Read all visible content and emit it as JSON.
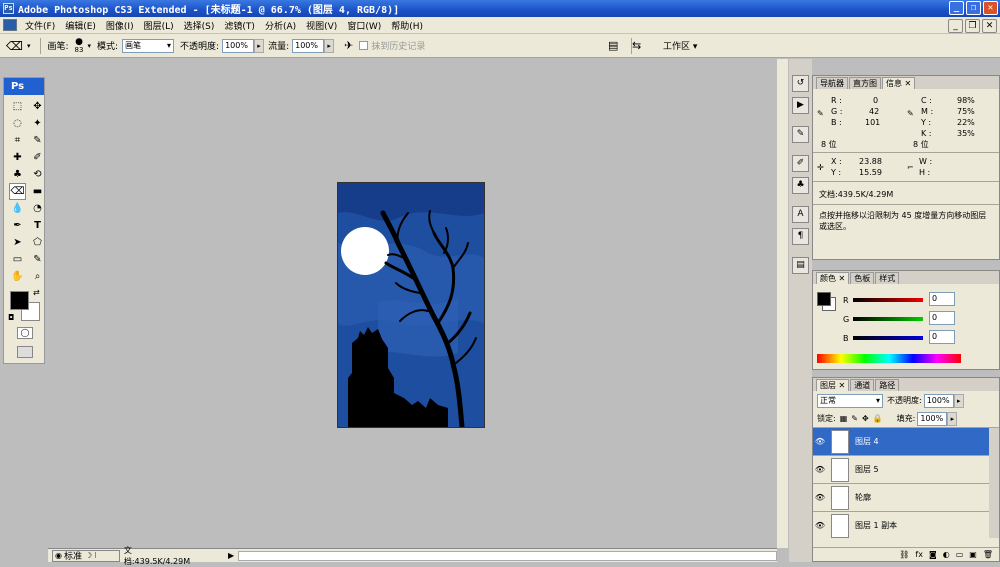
{
  "window": {
    "title": "Adobe Photoshop CS3 Extended - [未标题-1 @ 66.7% (图层 4, RGB/8)]",
    "logo": "Ps"
  },
  "menu": [
    "文件(F)",
    "编辑(E)",
    "图像(I)",
    "图层(L)",
    "选择(S)",
    "滤镜(T)",
    "分析(A)",
    "视图(V)",
    "窗口(W)",
    "帮助(H)"
  ],
  "options": {
    "brush_label": "画笔:",
    "brush_size": "83",
    "mode_label": "模式:",
    "mode_value": "画笔",
    "opacity_label": "不透明度:",
    "opacity_value": "100%",
    "flow_label": "流量:",
    "flow_value": "100%",
    "history_label": "抹到历史记录",
    "workspace_label": "工作区"
  },
  "toolbox": {
    "logo": "Ps"
  },
  "status": {
    "mode": "标准",
    "doc_info": "文档:439.5K/4.29M"
  },
  "info_panel": {
    "tabs": [
      "导航器",
      "直方图",
      "信息"
    ],
    "rgb": {
      "r_label": "R :",
      "r": "0",
      "g_label": "G :",
      "g": "42",
      "b_label": "B :",
      "b": "101"
    },
    "cmyk": {
      "c_label": "C :",
      "c": "98%",
      "m_label": "M :",
      "m": "75%",
      "y_label": "Y :",
      "y": "22%",
      "k_label": "K :",
      "k": "35%"
    },
    "bits_left": "8 位",
    "bits_right": "8 位",
    "xy": {
      "x_label": "X :",
      "x": "23.88",
      "y_label": "Y :",
      "y": "15.59"
    },
    "wh": {
      "w_label": "W :",
      "h_label": "H :"
    },
    "doc": "文档:439.5K/4.29M",
    "hint": "点按并拖移以沿限制为 45 度增量方向移动图层或选区。"
  },
  "color_panel": {
    "tabs": [
      "颜色",
      "色板",
      "样式"
    ],
    "r_label": "R",
    "g_label": "G",
    "b_label": "B",
    "r": "0",
    "g": "0",
    "b": "0"
  },
  "layers_panel": {
    "tabs": [
      "图层",
      "通道",
      "路径"
    ],
    "blend_mode": "正常",
    "opacity_label": "不透明度:",
    "opacity": "100%",
    "lock_label": "锁定:",
    "fill_label": "填充:",
    "fill": "100%",
    "layers": [
      {
        "name": "图层 4",
        "selected": true
      },
      {
        "name": "图层 5",
        "selected": false
      },
      {
        "name": "轮廓",
        "selected": false
      },
      {
        "name": "图层 1 副本",
        "selected": false
      }
    ]
  },
  "colors": {
    "title_blue": "#1a52c8",
    "selected_layer": "#3169c6",
    "artwork_blue": "#0a2a6a"
  }
}
